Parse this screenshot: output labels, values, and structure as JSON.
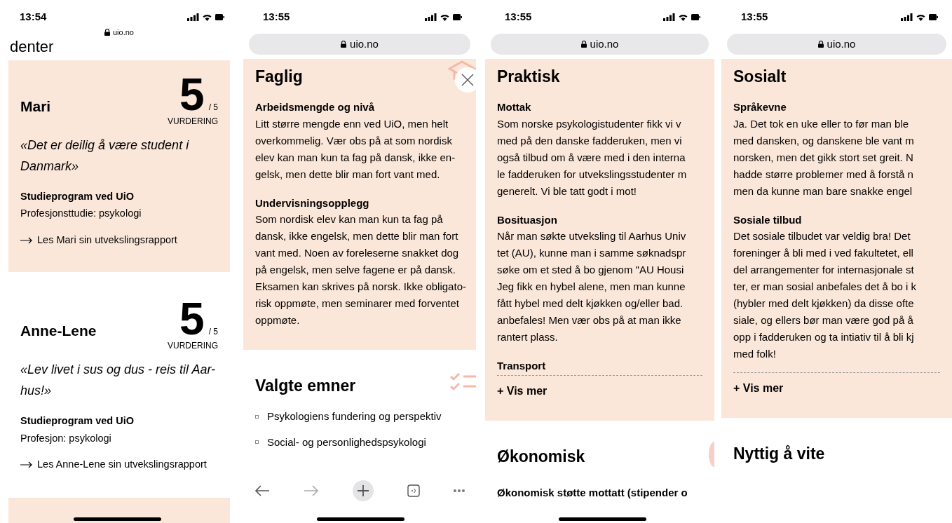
{
  "screens": [
    {
      "kind": "reviews",
      "time": "13:54",
      "url": "uio.no",
      "heading_fragment": "denter",
      "reviews": [
        {
          "name": "Mari",
          "score": "5",
          "out_of": "/ 5",
          "score_label": "VURDERING",
          "quote": [
            "«Det er deilig å være student i",
            "Danmark»"
          ],
          "program_label": "Studieprogram ved UiO",
          "program": "Profesjonsttudie: psykologi",
          "link": "Les Mari sin utvekslingsrapport",
          "highlighted": true
        },
        {
          "name": "Anne-Lene",
          "score": "5",
          "out_of": "/ 5",
          "score_label": "VURDERING",
          "quote": [
            "«Lev livet i sus og dus - reis til Aar-",
            "hus!»"
          ],
          "program_label": "Studieprogram ved UiO",
          "program": "Profesjon: psykologi",
          "link": "Les Anne-Lene sin utvekslingsrapport",
          "highlighted": false
        }
      ]
    },
    {
      "kind": "sections",
      "time": "13:55",
      "url": "uio.no",
      "sections": [
        {
          "title": "Faglig",
          "highlighted": true,
          "items": [
            {
              "heading": "Arbeidsmengde og nivå",
              "lines": [
                "Litt større mengde enn ved UiO, men helt",
                "overkommelig. Vær obs på at som nordisk",
                "elev kan man kun ta fag på dansk, ikke en-",
                "gelsk, men dette blir man fort vant med."
              ]
            },
            {
              "heading": "Undervisningsopplegg",
              "lines": [
                "Som nordisk elev kan man kun ta fag på",
                "dansk, ikke engelsk, men dette blir man fort",
                "vant med. Noen av foreleserne snakket dog",
                "på engelsk, men selve fagene er på dansk.",
                "Eksamen kan skrives på norsk. Ikke obligato-",
                "risk oppmøte, men seminarer med forventet",
                "oppmøte."
              ]
            }
          ]
        },
        {
          "title": "Valgte emner",
          "highlighted": false,
          "list": [
            "Psykologiens fundering og perspektiv",
            "Social- og personlighedspsykologi"
          ]
        }
      ]
    },
    {
      "kind": "sections",
      "time": "13:55",
      "url": "uio.no",
      "sections": [
        {
          "title": "Praktisk",
          "highlighted": true,
          "items": [
            {
              "heading": "Mottak",
              "lines": [
                "Som norske psykologistudenter fikk vi v",
                "med på den danske fadderuken, men vi",
                "også tilbud om å være med i den interna",
                "le fadderuken for utvekslingsstudenter m",
                "generelt. Vi ble tatt godt i mot!"
              ]
            },
            {
              "heading": "Bosituasjon",
              "lines": [
                "Når man søkte utveksling til Aarhus Univ",
                "tet (AU), kunne man i samme søknadspr",
                "søke om et sted å bo gjenom \"AU Housi",
                "Jeg fikk en hybel alene, men man kunne",
                "fått hybel med delt kjøkken og/eller bad.",
                "anbefales! Men vær obs på at man ikke",
                "rantert plass."
              ]
            },
            {
              "heading": "Transport"
            }
          ],
          "more": "+ Vis mer"
        },
        {
          "title": "Økonomisk",
          "highlighted": false,
          "items": [
            {
              "heading": "Økonomisk støtte mottatt (stipender o"
            }
          ]
        }
      ]
    },
    {
      "kind": "sections",
      "time": "13:55",
      "url": "uio.no",
      "sections": [
        {
          "title": "Sosialt",
          "highlighted": true,
          "items": [
            {
              "heading": "Språkevne",
              "lines": [
                "Ja. Det tok en uke eller to før man ble",
                "med dansken, og danskene ble vant m",
                "norsken, men det gikk stort set greit. N",
                "hadde større problemer med å forstå n",
                "men da kunne man bare snakke engel"
              ]
            },
            {
              "heading": "Sosiale tilbud",
              "lines": [
                "Det sosiale tilbudet var veldig bra! Det",
                "foreninger å bli med i ved fakultetet, ell",
                "del arrangementer for internasjonale st",
                "ter, er man sosial anbefales det å bo i k",
                "(hybler med delt kjøkken) da disse ofte",
                "siale, og ellers bør man være god på å",
                "opp i fadderuken og ta intiativ til å bli kj",
                "med folk!"
              ]
            }
          ],
          "more": "+ Vis mer"
        },
        {
          "title": "Nyttig å vite",
          "highlighted": false
        }
      ]
    }
  ]
}
